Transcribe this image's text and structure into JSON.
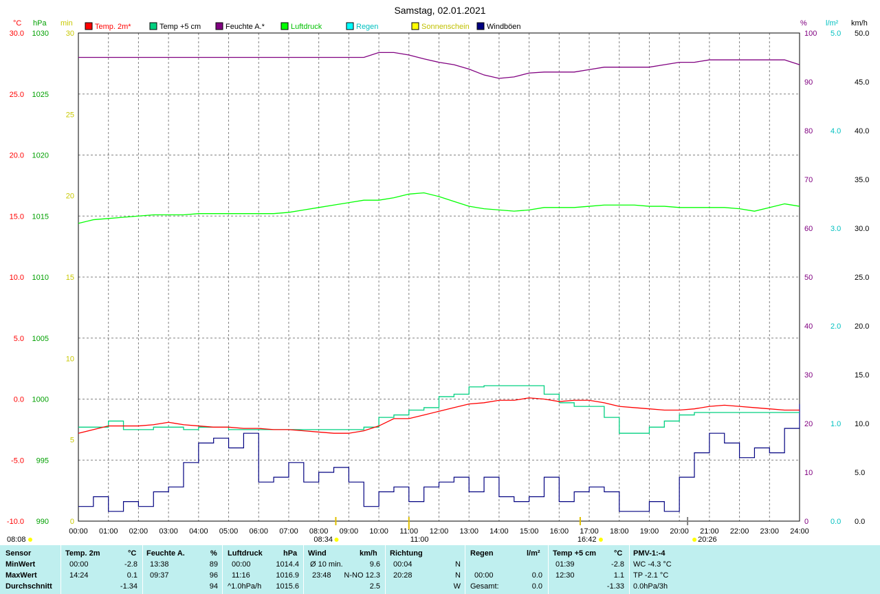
{
  "title": "Samstag, 02.01.2021",
  "legend": [
    {
      "label": "Temp. 2m*",
      "color": "#ff0000",
      "text_color": "#ff0000"
    },
    {
      "label": "Temp +5 cm",
      "color": "#00d080",
      "text_color": "#000000"
    },
    {
      "label": "Feuchte A.*",
      "color": "#800080",
      "text_color": "#000000"
    },
    {
      "label": "Luftdruck",
      "color": "#00ff00",
      "text_color": "#00c000"
    },
    {
      "label": "Regen",
      "color": "#00ffff",
      "text_color": "#00c0c0"
    },
    {
      "label": "Sonnenschein",
      "color": "#ffff00",
      "text_color": "#c0c000"
    },
    {
      "label": "Windböen",
      "color": "#000080",
      "text_color": "#000000"
    }
  ],
  "axes": {
    "temp": {
      "unit": "°C",
      "color": "#ff0000",
      "ticks": [
        "30.0",
        "25.0",
        "20.0",
        "15.0",
        "10.0",
        "5.0",
        "0.0",
        "-5.0",
        "-10.0"
      ]
    },
    "press": {
      "unit": "hPa",
      "color": "#00a000",
      "ticks": [
        "1030",
        "1025",
        "1020",
        "1015",
        "1010",
        "1005",
        "1000",
        "995",
        "990"
      ]
    },
    "sun": {
      "unit": "min",
      "color": "#c8c800",
      "ticks": [
        "30",
        "25",
        "20",
        "15",
        "10",
        "5",
        "0"
      ]
    },
    "hum": {
      "unit": "%",
      "color": "#800080",
      "ticks": [
        "100",
        "90",
        "80",
        "70",
        "60",
        "50",
        "40",
        "30",
        "20",
        "10",
        "0"
      ]
    },
    "rain": {
      "unit": "l/m²",
      "color": "#00c0c0",
      "ticks": [
        "5.0",
        "4.0",
        "3.0",
        "2.0",
        "1.0",
        "0.0"
      ]
    },
    "wind": {
      "unit": "km/h",
      "color": "#000000",
      "ticks": [
        "50.0",
        "45.0",
        "40.0",
        "35.0",
        "30.0",
        "25.0",
        "20.0",
        "15.0",
        "10.0",
        "5.0",
        "0.0"
      ]
    },
    "x_ticks": [
      "00:00",
      "01:00",
      "02:00",
      "03:00",
      "04:00",
      "05:00",
      "06:00",
      "07:00",
      "08:00",
      "09:00",
      "10:00",
      "11:00",
      "12:00",
      "13:00",
      "14:00",
      "15:00",
      "16:00",
      "17:00",
      "18:00",
      "19:00",
      "20:00",
      "21:00",
      "22:00",
      "23:00",
      "24:00"
    ]
  },
  "sun_events": {
    "sunrise": "08:08",
    "sunset": "16:42",
    "sunshine_start": "08:34",
    "noon": "11:00",
    "extra": "20:26"
  },
  "chart_data": {
    "type": "line",
    "x_unit": "hour",
    "series": [
      {
        "name": "Temp. 2m*",
        "unit": "°C",
        "x": [
          0,
          0.5,
          1,
          1.5,
          2,
          2.5,
          3,
          3.5,
          4,
          4.5,
          5,
          5.5,
          6,
          6.5,
          7,
          7.5,
          8,
          8.5,
          9,
          9.5,
          10,
          10.5,
          11,
          11.5,
          12,
          12.5,
          13,
          13.5,
          14,
          14.5,
          15,
          15.5,
          16,
          16.5,
          17,
          17.5,
          18,
          18.5,
          19,
          19.5,
          20,
          20.5,
          21,
          21.5,
          22,
          22.5,
          23,
          23.5,
          24
        ],
        "y": [
          -2.8,
          -2.5,
          -2.2,
          -2.2,
          -2.2,
          -2.1,
          -1.9,
          -2.1,
          -2.2,
          -2.3,
          -2.3,
          -2.4,
          -2.4,
          -2.5,
          -2.5,
          -2.6,
          -2.7,
          -2.8,
          -2.8,
          -2.6,
          -2.2,
          -1.6,
          -1.6,
          -1.3,
          -1.0,
          -0.7,
          -0.4,
          -0.3,
          -0.1,
          -0.1,
          0.1,
          0.0,
          -0.2,
          -0.1,
          -0.1,
          -0.3,
          -0.6,
          -0.7,
          -0.8,
          -0.9,
          -0.9,
          -0.8,
          -0.6,
          -0.5,
          -0.6,
          -0.7,
          -0.8,
          -0.9,
          -0.9
        ]
      },
      {
        "name": "Temp +5 cm",
        "unit": "°C",
        "x": [
          0,
          0.5,
          1,
          1.5,
          2,
          2.5,
          3,
          3.5,
          4,
          4.5,
          5,
          5.5,
          6,
          6.5,
          7,
          7.5,
          8,
          8.5,
          9,
          9.5,
          10,
          10.5,
          11,
          11.5,
          12,
          12.5,
          13,
          13.5,
          14,
          14.5,
          15,
          15.5,
          16,
          16.5,
          17,
          17.5,
          18,
          18.5,
          19,
          19.5,
          20,
          20.5,
          21,
          21.5,
          22,
          22.5,
          23,
          23.5,
          24
        ],
        "y": [
          -2.3,
          -2.3,
          -1.8,
          -2.5,
          -2.5,
          -2.3,
          -2.3,
          -2.5,
          -2.3,
          -2.3,
          -2.5,
          -2.5,
          -2.5,
          -2.5,
          -2.5,
          -2.5,
          -2.5,
          -2.5,
          -2.5,
          -2.3,
          -1.5,
          -1.3,
          -0.9,
          -0.7,
          0.2,
          0.4,
          1.0,
          1.1,
          1.1,
          1.1,
          1.1,
          0.4,
          -0.3,
          -0.6,
          -0.6,
          -1.5,
          -2.8,
          -2.8,
          -2.3,
          -1.8,
          -1.3,
          -1.1,
          -1.1,
          -1.1,
          -1.1,
          -1.1,
          -1.1,
          -1.1,
          -1.1
        ]
      },
      {
        "name": "Feuchte A.*",
        "unit": "%",
        "x": [
          0,
          1,
          2,
          3,
          4,
          5,
          6,
          7,
          8,
          9,
          9.5,
          10,
          10.5,
          11,
          11.5,
          12,
          12.5,
          13,
          13.5,
          14,
          14.5,
          15,
          15.5,
          16,
          16.5,
          17,
          17.5,
          18,
          18.5,
          19,
          19.5,
          20,
          20.5,
          21,
          21.5,
          22,
          22.5,
          23,
          23.5,
          24
        ],
        "y": [
          95,
          95,
          95,
          95,
          95,
          95,
          95,
          95,
          95,
          95,
          95,
          96,
          96,
          95.5,
          94.7,
          94,
          93.5,
          92.6,
          91.4,
          90.7,
          91,
          91.8,
          92,
          92,
          92,
          92.5,
          93,
          93,
          93,
          93,
          93.5,
          94,
          94,
          94.5,
          94.5,
          94.5,
          94.5,
          94.5,
          94.5,
          93.5
        ]
      },
      {
        "name": "Luftdruck",
        "unit": "hPa",
        "x": [
          0,
          0.5,
          1,
          1.5,
          2,
          2.5,
          3,
          3.5,
          4,
          4.5,
          5,
          5.5,
          6,
          6.5,
          7,
          7.5,
          8,
          8.5,
          9,
          9.5,
          10,
          10.5,
          11,
          11.5,
          12,
          12.5,
          13,
          13.5,
          14,
          14.5,
          15,
          15.5,
          16,
          16.5,
          17,
          17.5,
          18,
          18.5,
          19,
          19.5,
          20,
          20.5,
          21,
          21.5,
          22,
          22.5,
          23,
          23.5,
          24
        ],
        "y": [
          1014.4,
          1014.7,
          1014.8,
          1014.9,
          1015.0,
          1015.1,
          1015.1,
          1015.1,
          1015.2,
          1015.2,
          1015.2,
          1015.2,
          1015.2,
          1015.2,
          1015.3,
          1015.5,
          1015.7,
          1015.9,
          1016.1,
          1016.3,
          1016.3,
          1016.5,
          1016.8,
          1016.9,
          1016.6,
          1016.2,
          1015.8,
          1015.6,
          1015.5,
          1015.4,
          1015.5,
          1015.7,
          1015.7,
          1015.7,
          1015.8,
          1015.9,
          1015.9,
          1015.9,
          1015.8,
          1015.8,
          1015.7,
          1015.7,
          1015.7,
          1015.7,
          1015.6,
          1015.4,
          1015.7,
          1016.0,
          1015.8
        ]
      },
      {
        "name": "Windböen",
        "unit": "km/h",
        "x": [
          0,
          0.5,
          1,
          1.5,
          2,
          2.5,
          3,
          3.5,
          4,
          4.5,
          5,
          5.5,
          6,
          6.5,
          7,
          7.5,
          8,
          8.5,
          9,
          9.5,
          10,
          10.5,
          11,
          11.5,
          12,
          12.5,
          13,
          13.5,
          14,
          14.5,
          15,
          15.5,
          16,
          16.5,
          17,
          17.5,
          18,
          18.5,
          19,
          19.5,
          20,
          20.5,
          21,
          21.5,
          22,
          22.5,
          23,
          23.5,
          24
        ],
        "y": [
          1.5,
          2.5,
          1.0,
          2.0,
          1.5,
          3.0,
          3.5,
          6.0,
          8.0,
          8.5,
          7.5,
          9.0,
          4.0,
          4.5,
          6.0,
          4.0,
          5.0,
          5.5,
          4.0,
          1.5,
          3.0,
          3.5,
          2.0,
          3.5,
          4.0,
          4.5,
          3.0,
          4.5,
          2.5,
          2.0,
          2.5,
          4.5,
          2.0,
          3.0,
          3.5,
          3.0,
          1.0,
          1.0,
          2.0,
          1.0,
          4.5,
          7.0,
          9.0,
          8.0,
          6.5,
          7.5,
          7.0,
          9.5,
          12.0
        ]
      }
    ],
    "ranges": {
      "temp": [
        -10,
        30
      ],
      "press": [
        990,
        1030
      ],
      "hum": [
        0,
        100
      ],
      "rain": [
        0,
        5
      ],
      "wind": [
        0,
        50
      ],
      "sun": [
        0,
        30
      ],
      "x": [
        0,
        24
      ]
    },
    "grid": true,
    "legend_position": "top"
  },
  "stats": {
    "headers": {
      "sensor": "Sensor",
      "temp": "Temp. 2m",
      "temp_unit": "°C",
      "hum": "Feuchte A.",
      "hum_unit": "%",
      "press": "Luftdruck",
      "press_unit": "hPa",
      "wind": "Wind",
      "wind_unit": "km/h",
      "dir": "Richtung",
      "rain": "Regen",
      "rain_unit": "l/m²",
      "t5": "Temp +5 cm",
      "t5_unit": "°C",
      "pmv": "PMV-1:-4"
    },
    "rows": [
      {
        "label": "MinWert",
        "temp_t": "00:00",
        "temp_v": "-2.8",
        "hum_t": "13:38",
        "hum_v": "89",
        "press_t": "00:00",
        "press_v": "1014.4",
        "wind_t": "Ø 10 min.",
        "wind_v": "9.6",
        "dir_t": "00:04",
        "dir_v": "N",
        "rain_t": "",
        "rain_v": "",
        "t5_t": "01:39",
        "t5_v": "-2.8",
        "pmv": "WC -4.3 °C"
      },
      {
        "label": "MaxWert",
        "temp_t": "14:24",
        "temp_v": "0.1",
        "hum_t": "09:37",
        "hum_v": "96",
        "press_t": "11:16",
        "press_v": "1016.9",
        "wind_t": "23:48",
        "wind_v": "N-NO 12.3",
        "dir_t": "20:28",
        "dir_v": "N",
        "rain_t": "00:00",
        "rain_v": "0.0",
        "t5_t": "12:30",
        "t5_v": "1.1",
        "pmv": "TP -2.1 °C"
      },
      {
        "label": "Durchschnitt",
        "temp_t": "",
        "temp_v": "-1.34",
        "hum_t": "",
        "hum_v": "94",
        "press_t": "^1.0hPa/h",
        "press_v": "1015.6",
        "wind_t": "",
        "wind_v": "2.5",
        "dir_t": "",
        "dir_v": "W",
        "rain_t": "Gesamt:",
        "rain_v": "0.0",
        "t5_t": "",
        "t5_v": "-1.33",
        "pmv": "0.0hPa/3h"
      }
    ]
  }
}
